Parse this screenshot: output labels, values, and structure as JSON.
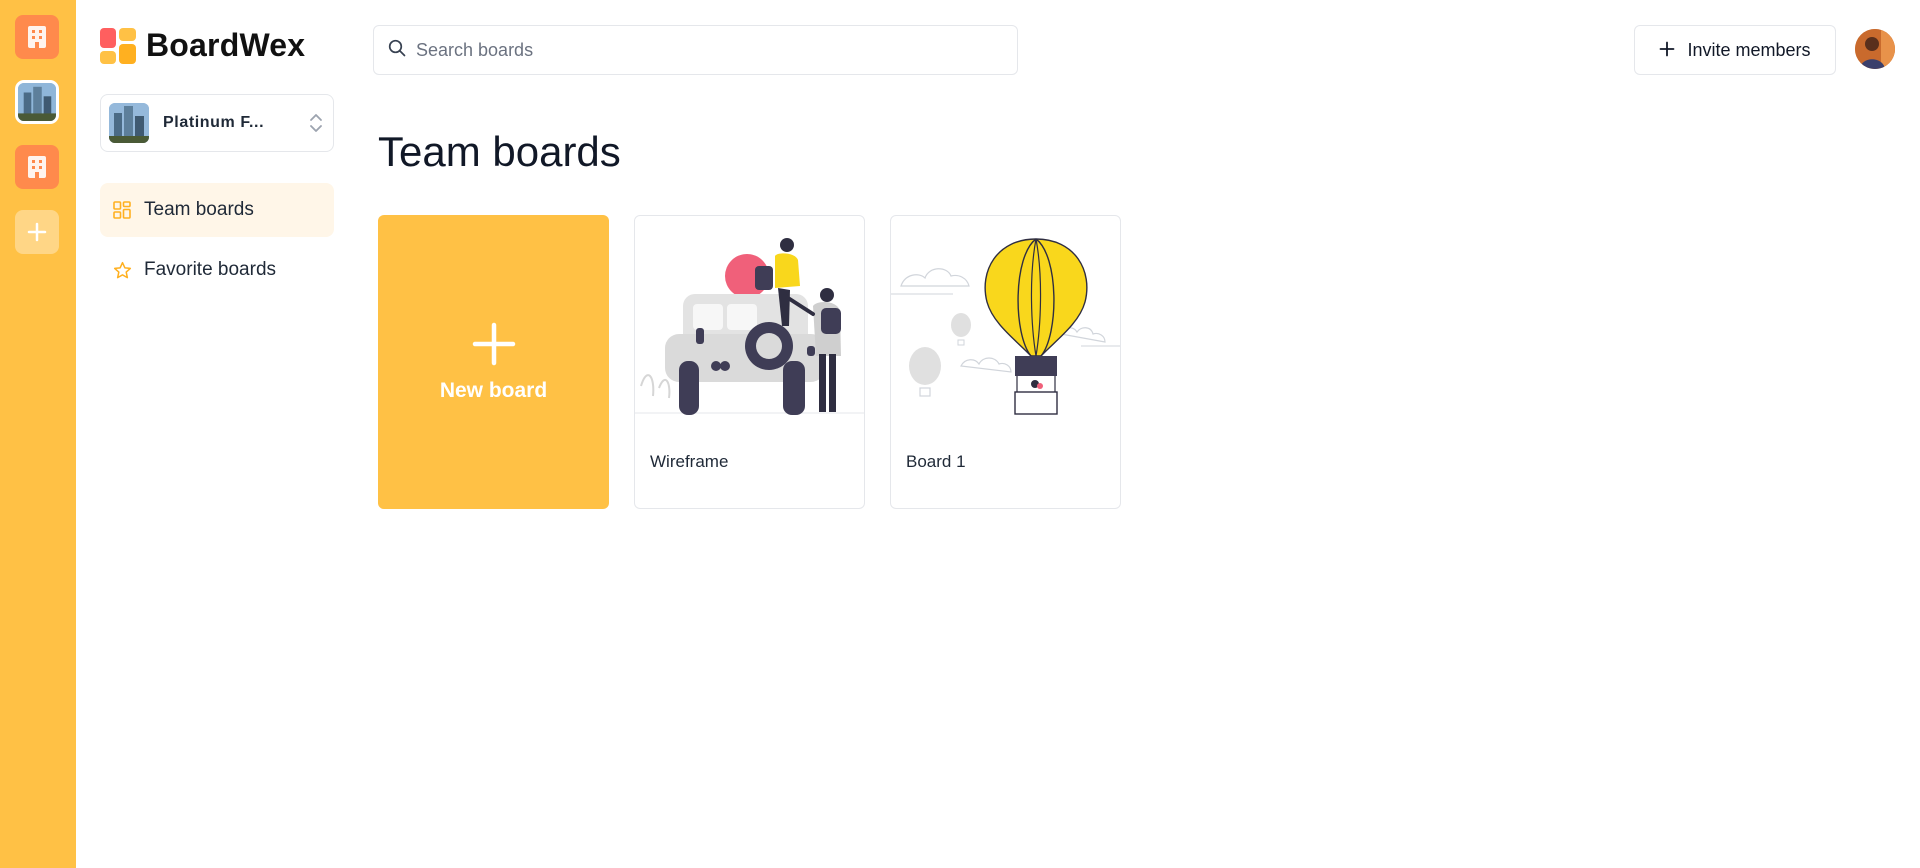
{
  "app": {
    "name": "BoardWex"
  },
  "org_rail": {
    "items": [
      {
        "name": "building-org-1",
        "icon": "building-icon"
      },
      {
        "name": "platinum-org",
        "icon": "org-photo"
      },
      {
        "name": "building-org-2",
        "icon": "building-icon"
      },
      {
        "name": "add-org",
        "icon": "plus-icon"
      }
    ]
  },
  "sidebar": {
    "org_switcher": {
      "name": "Platinum F..."
    },
    "nav": [
      {
        "label": "Team boards",
        "icon": "grid-icon",
        "active": true
      },
      {
        "label": "Favorite boards",
        "icon": "star-icon",
        "active": false
      }
    ]
  },
  "header": {
    "search": {
      "placeholder": "Search boards",
      "value": ""
    },
    "invite_label": "Invite members"
  },
  "main": {
    "title": "Team boards",
    "new_board_label": "New board",
    "boards": [
      {
        "title": "Wireframe",
        "image": "people-jeep-illustration"
      },
      {
        "title": "Board 1",
        "image": "hot-air-balloon-illustration"
      }
    ]
  },
  "colors": {
    "accent": "#ffc145",
    "accent_light": "#fff6e8",
    "org_icon": "#ff8a4c"
  }
}
